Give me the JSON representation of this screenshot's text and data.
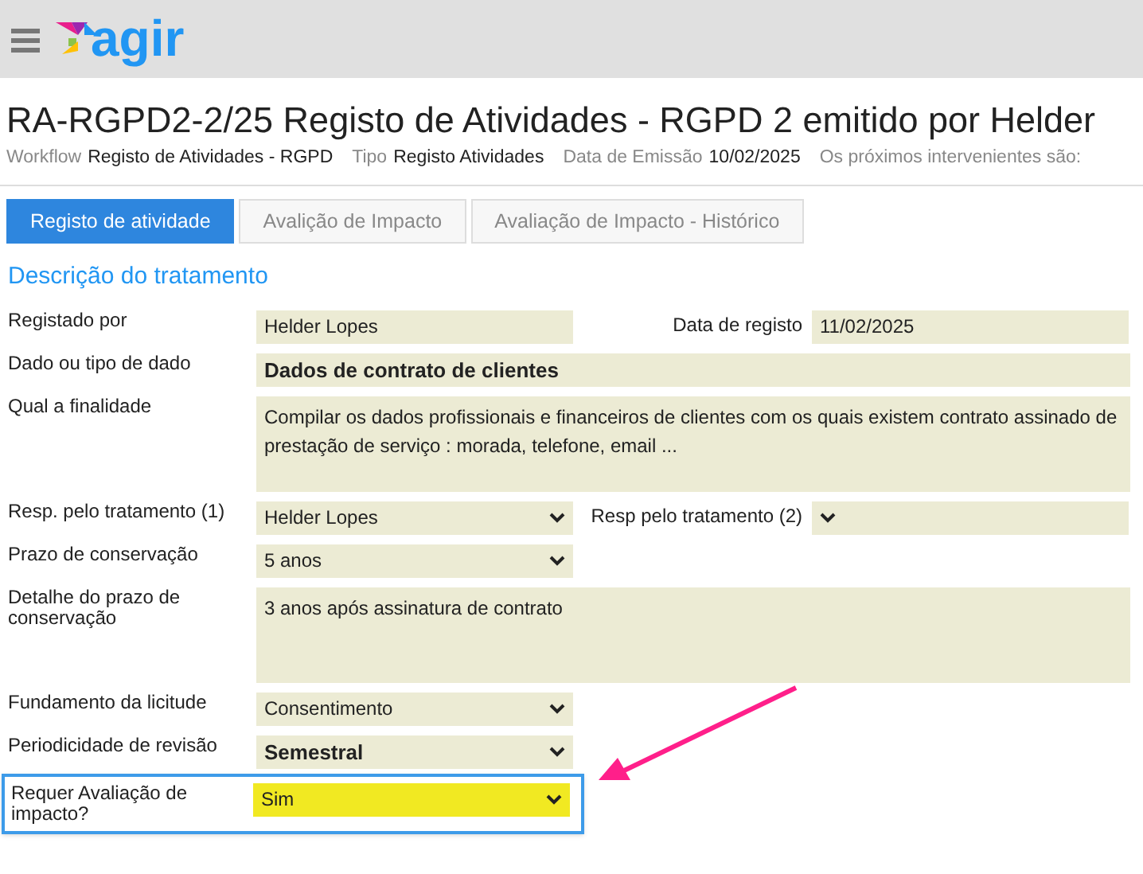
{
  "header": {
    "logo_text": "agir"
  },
  "title": "RA-RGPD2-2/25 Registo de Atividades - RGPD 2 emitido por Helder",
  "meta": [
    {
      "label": "Workflow",
      "value": "Registo de Atividades - RGPD"
    },
    {
      "label": "Tipo",
      "value": "Registo Atividades"
    },
    {
      "label": "Data de Emissão",
      "value": "10/02/2025"
    },
    {
      "label": "Os próximos intervenientes são:"
    }
  ],
  "tabs": [
    {
      "label": "Registo de atividade",
      "selected": true
    },
    {
      "label": "Avalição de Impacto",
      "selected": false
    },
    {
      "label": "Avaliação de Impacto - Histórico",
      "selected": false
    }
  ],
  "section_title": "Descrição do tratamento",
  "rows": [
    {
      "highlighted": false,
      "fields": [
        {
          "label": "Registado por",
          "kind": "text",
          "value": "Helder Lopes",
          "bold": false
        },
        {
          "label": "Data de registo",
          "kind": "text",
          "value": "11/02/2025",
          "bold": false
        }
      ]
    },
    {
      "highlighted": false,
      "fields": [
        {
          "label": "Dado ou tipo de dado",
          "kind": "wide",
          "value": "Dados de contrato de clientes",
          "bold": true
        }
      ]
    },
    {
      "highlighted": false,
      "fields": [
        {
          "label": "Qual a finalidade",
          "kind": "textarea",
          "value": "Compilar os dados profissionais e financeiros de clientes com os quais existem contrato assinado de prestação de serviço : morada, telefone, email ...",
          "bold": false
        }
      ]
    },
    {
      "highlighted": false,
      "fields": [
        {
          "label": "Resp. pelo tratamento (1)",
          "kind": "select",
          "value": "Helder Lopes",
          "bold": false
        },
        {
          "label": "Resp pelo tratamento (2)",
          "kind": "select"
        }
      ]
    },
    {
      "highlighted": false,
      "fields": [
        {
          "label": "Prazo de conservação",
          "kind": "select",
          "value": "5 anos",
          "bold": false
        }
      ]
    },
    {
      "highlighted": false,
      "fields": [
        {
          "label": "Detalhe do prazo de conservação",
          "kind": "textarea",
          "value": "3 anos após assinatura de contrato",
          "bold": false
        }
      ]
    },
    {
      "highlighted": false,
      "fields": [
        {
          "label": "Fundamento da licitude",
          "kind": "select",
          "value": "Consentimento",
          "bold": false
        }
      ]
    },
    {
      "highlighted": false,
      "fields": [
        {
          "label": "Periodicidade de revisão",
          "kind": "select",
          "value": "Semestral",
          "bold": true
        }
      ]
    },
    {
      "highlighted": true,
      "fields": [
        {
          "label": "Requer Avaliação de impacto?",
          "kind": "select",
          "value": "Sim",
          "bold": false
        }
      ]
    }
  ]
}
